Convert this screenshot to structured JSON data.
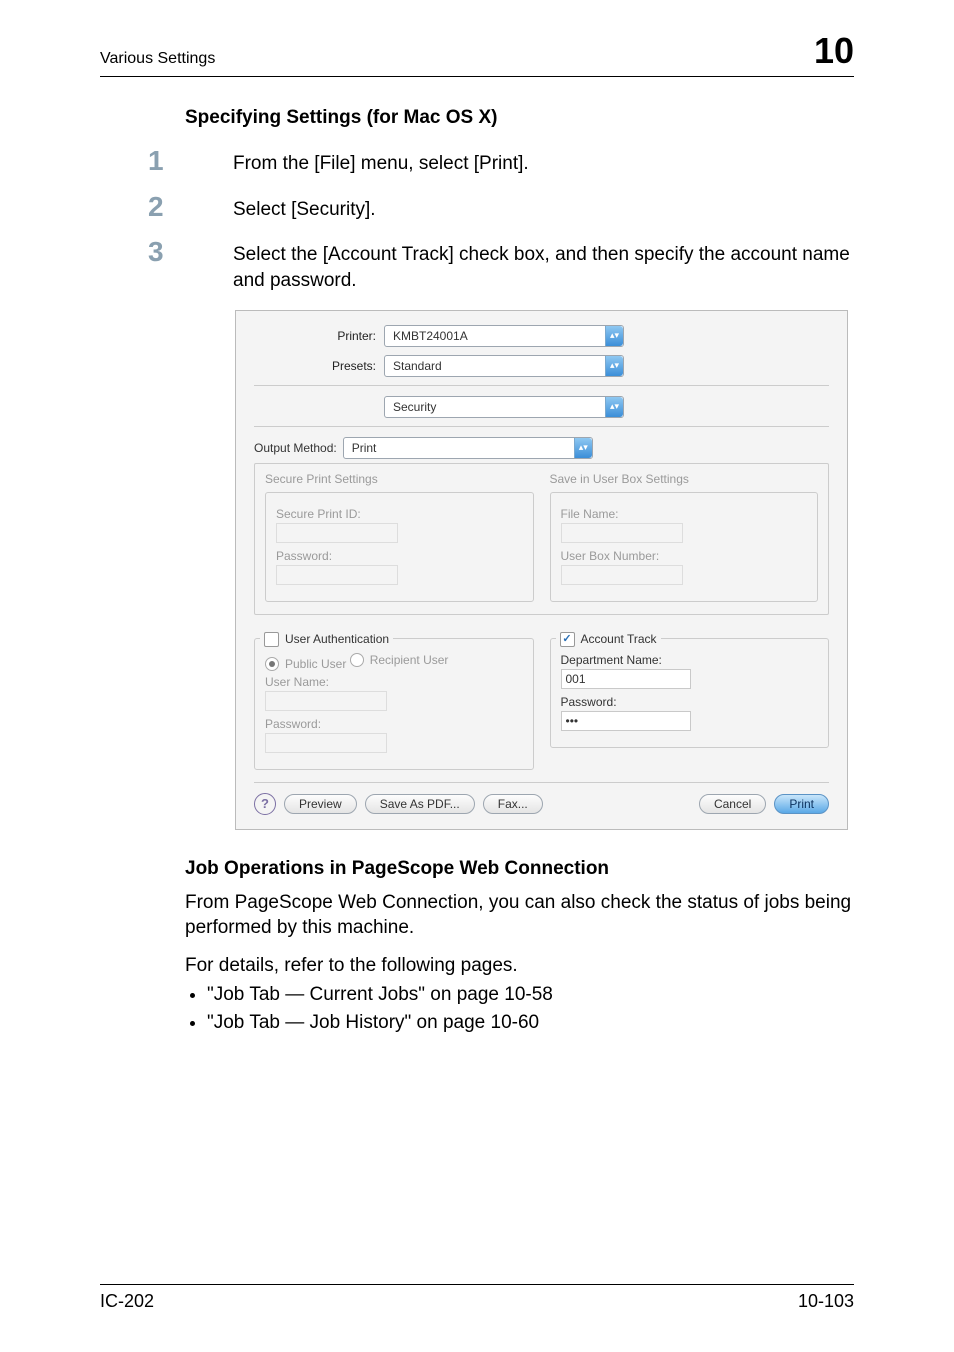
{
  "header": {
    "title": "Various Settings",
    "chapter": "10"
  },
  "section_heading": "Specifying Settings (for Mac OS X)",
  "steps": [
    {
      "num": "1",
      "text": "From the [File] menu, select [Print]."
    },
    {
      "num": "2",
      "text": "Select [Security]."
    },
    {
      "num": "3",
      "text": "Select the [Account Track] check box, and then specify the account name and password."
    }
  ],
  "dialog": {
    "printer_label": "Printer:",
    "printer_value": "KMBT24001A",
    "presets_label": "Presets:",
    "presets_value": "Standard",
    "pane_value": "Security",
    "output_method_label": "Output Method:",
    "output_method_value": "Print",
    "secure_print_title": "Secure Print Settings",
    "save_box_title": "Save in User Box Settings",
    "secure_print_id_label": "Secure Print ID:",
    "secure_password_label": "Password:",
    "file_name_label": "File Name:",
    "user_box_num_label": "User Box Number:",
    "user_auth_title": "User Authentication",
    "account_track_title": "Account Track",
    "public_user_label": "Public User",
    "recipient_user_label": "Recipient User",
    "user_name_label": "User Name:",
    "ua_password_label": "Password:",
    "department_name_label": "Department Name:",
    "department_name_value": "001",
    "at_password_label": "Password:",
    "at_password_value": "•••",
    "buttons": {
      "preview": "Preview",
      "save_as_pdf": "Save As PDF...",
      "fax": "Fax...",
      "cancel": "Cancel",
      "print": "Print"
    }
  },
  "sub_heading": "Job Operations in PageScope Web Connection",
  "body1": "From PageScope Web Connection, you can also check the status of jobs being performed by this machine.",
  "body2": "For details, refer to the following pages.",
  "bullets": [
    "\"Job Tab — Current Jobs\" on page 10-58",
    "\"Job Tab — Job History\" on page 10-60"
  ],
  "footer": {
    "left": "IC-202",
    "right": "10-103"
  }
}
